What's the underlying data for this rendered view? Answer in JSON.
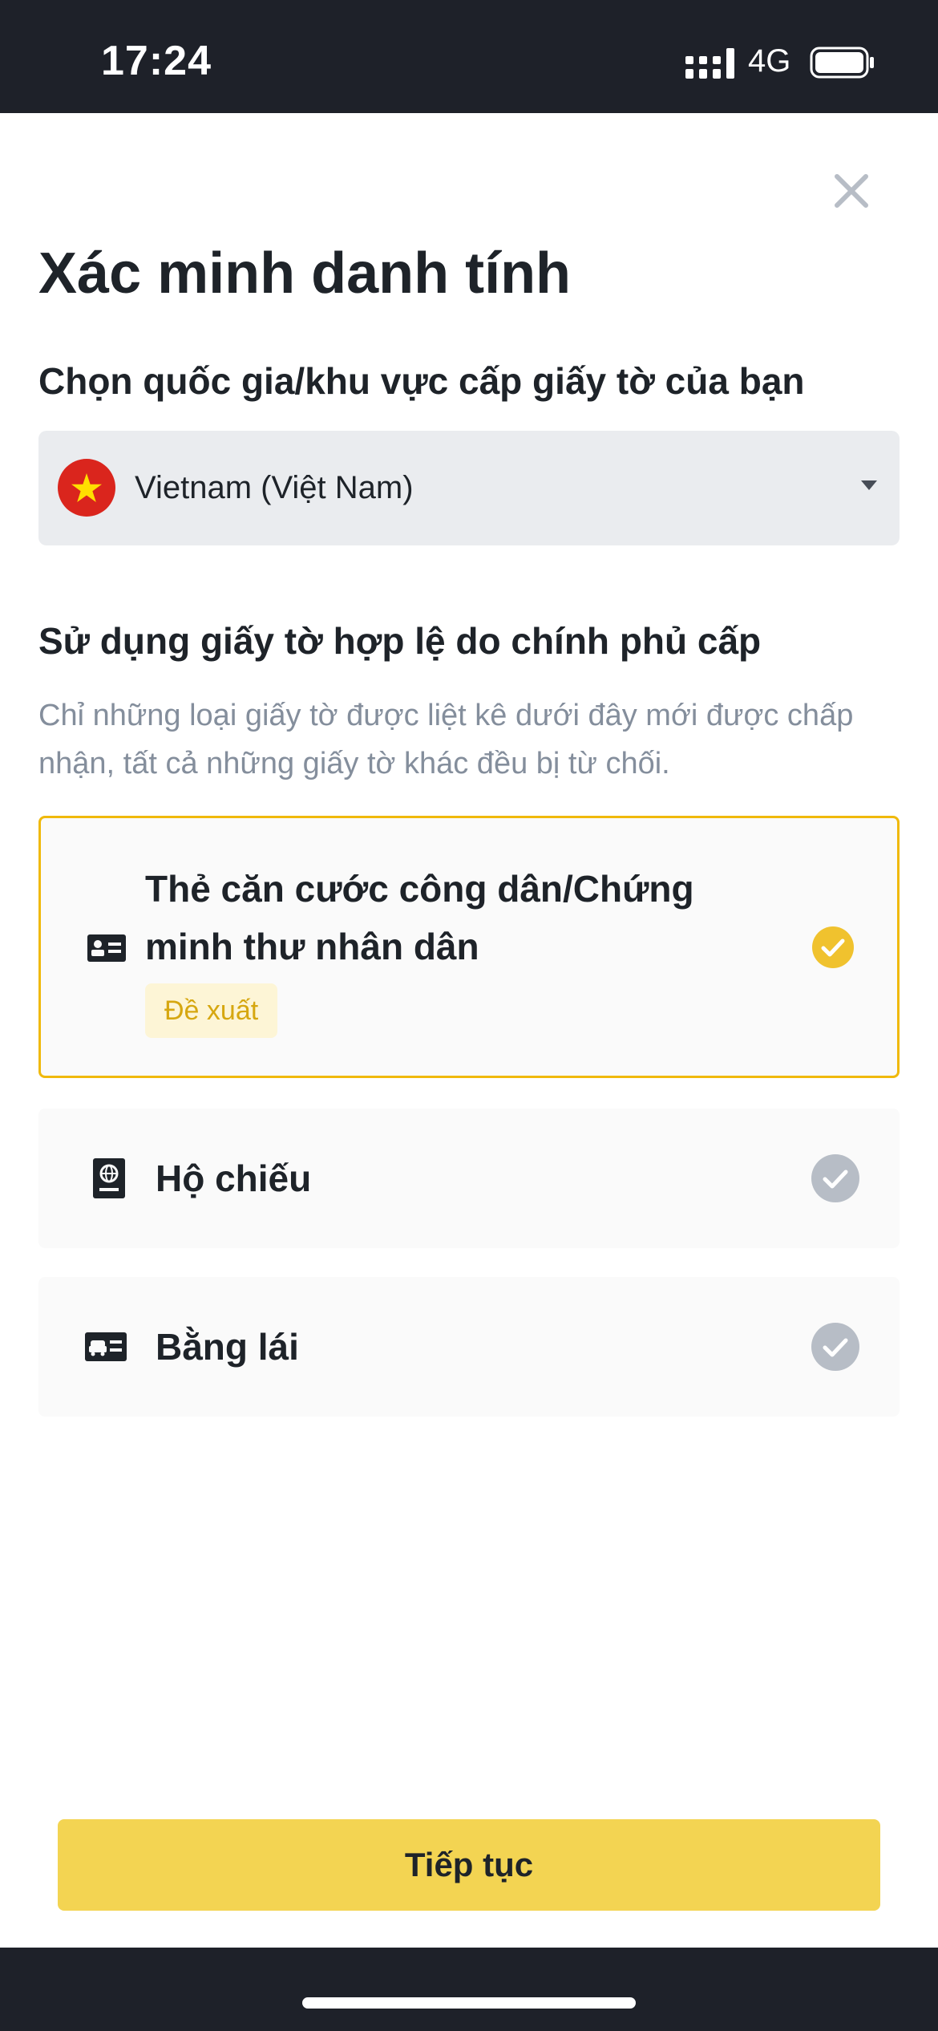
{
  "status_bar": {
    "time": "17:24",
    "network": "4G",
    "icons": [
      "signal-icon",
      "battery-icon"
    ]
  },
  "header": {
    "close_icon": "close-icon",
    "title": "Xác minh danh tính"
  },
  "country": {
    "label": "Chọn quốc gia/khu vực cấp giấy tờ của bạn",
    "selected": "Vietnam (Việt Nam)",
    "flag_icon": "vietnam-flag-icon",
    "dropdown_icon": "caret-down-icon"
  },
  "documents": {
    "heading": "Sử dụng giấy tờ hợp lệ do chính phủ cấp",
    "note": "Chỉ những loại giấy tờ được liệt kê dưới đây mới được chấp nhận, tất cả những giấy tờ khác đều bị từ chối.",
    "options": [
      {
        "label": "Thẻ căn cước công dân/Chứng minh thư nhân dân",
        "badge": "Đề xuất",
        "icon": "id-card-icon",
        "selected": true
      },
      {
        "label": "Hộ chiếu",
        "icon": "passport-icon",
        "selected": false
      },
      {
        "label": "Bằng lái",
        "icon": "driver-license-icon",
        "selected": false
      }
    ]
  },
  "colors": {
    "accent": "#f0b90b",
    "button": "#f3d452",
    "check_selected": "#f0c22e",
    "check_unselected": "#b7bdc6",
    "dark_bar": "#1e2129"
  },
  "footer": {
    "continue_label": "Tiếp tục"
  }
}
